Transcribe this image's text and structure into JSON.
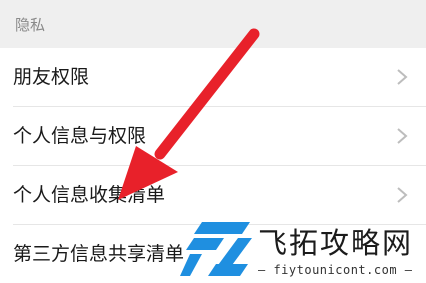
{
  "section": {
    "title": "隐私"
  },
  "rows": [
    {
      "label": "朋友权限"
    },
    {
      "label": "个人信息与权限"
    },
    {
      "label": "个人信息收集清单"
    },
    {
      "label": "第三方信息共享清单"
    }
  ],
  "watermark": {
    "title": "飞拓攻略网",
    "url": "— fiytounicont.com —"
  },
  "colors": {
    "annotation_arrow": "#e8212a",
    "section_background": "#efefef",
    "chevron": "#bdbdbd",
    "watermark_blue": "#1f8fe0"
  },
  "icons": {
    "row_trailing": "chevron-right-icon",
    "annotation": "red-arrow-icon"
  }
}
